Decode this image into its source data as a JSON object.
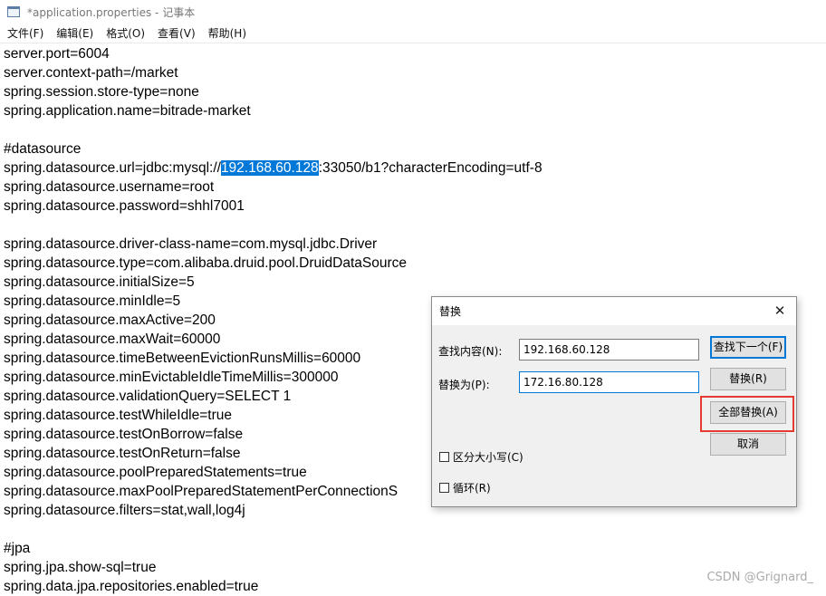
{
  "window": {
    "title": "*application.properties - 记事本"
  },
  "menu": [
    {
      "label": "文件(F)"
    },
    {
      "label": "编辑(E)"
    },
    {
      "label": "格式(O)"
    },
    {
      "label": "查看(V)"
    },
    {
      "label": "帮助(H)"
    }
  ],
  "editor": {
    "url_prefix": "spring.datasource.url=jdbc:mysql://",
    "url_selected": "192.168.60.128",
    "url_suffix": ":33050/b1?characterEncoding=utf-8",
    "lines": [
      "server.port=6004",
      "server.context-path=/market",
      "spring.session.store-type=none",
      "spring.application.name=bitrade-market",
      "",
      "#datasource",
      "__URL__",
      "spring.datasource.username=root",
      "spring.datasource.password=shhl7001",
      "",
      "spring.datasource.driver-class-name=com.mysql.jdbc.Driver",
      "spring.datasource.type=com.alibaba.druid.pool.DruidDataSource",
      "spring.datasource.initialSize=5",
      "spring.datasource.minIdle=5",
      "spring.datasource.maxActive=200",
      "spring.datasource.maxWait=60000",
      "spring.datasource.timeBetweenEvictionRunsMillis=60000",
      "spring.datasource.minEvictableIdleTimeMillis=300000",
      "spring.datasource.validationQuery=SELECT 1",
      "spring.datasource.testWhileIdle=true",
      "spring.datasource.testOnBorrow=false",
      "spring.datasource.testOnReturn=false",
      "spring.datasource.poolPreparedStatements=true",
      "spring.datasource.maxPoolPreparedStatementPerConnectionS",
      "spring.datasource.filters=stat,wall,log4j",
      "",
      "#jpa",
      "spring.jpa.show-sql=true",
      "spring.data.jpa.repositories.enabled=true"
    ]
  },
  "dialog": {
    "title": "替换",
    "find_label": "查找内容(N):",
    "find_value": "192.168.60.128",
    "replace_label": "替换为(P):",
    "replace_value": "172.16.80.128",
    "find_next_button": "查找下一个(F)",
    "replace_button": "替换(R)",
    "replace_all_button": "全部替换(A)",
    "cancel_button": "取消",
    "match_case_label": "区分大小写(C)",
    "match_case_checked": false,
    "wrap_label": "循环(R)",
    "wrap_checked": false,
    "close_glyph": "✕"
  },
  "watermark": "CSDN @Grignard_",
  "colors": {
    "selection": "#0078d7",
    "highlight_box": "#e33b32"
  },
  "icons": {
    "app": "notepad-icon",
    "close": "close-icon"
  }
}
